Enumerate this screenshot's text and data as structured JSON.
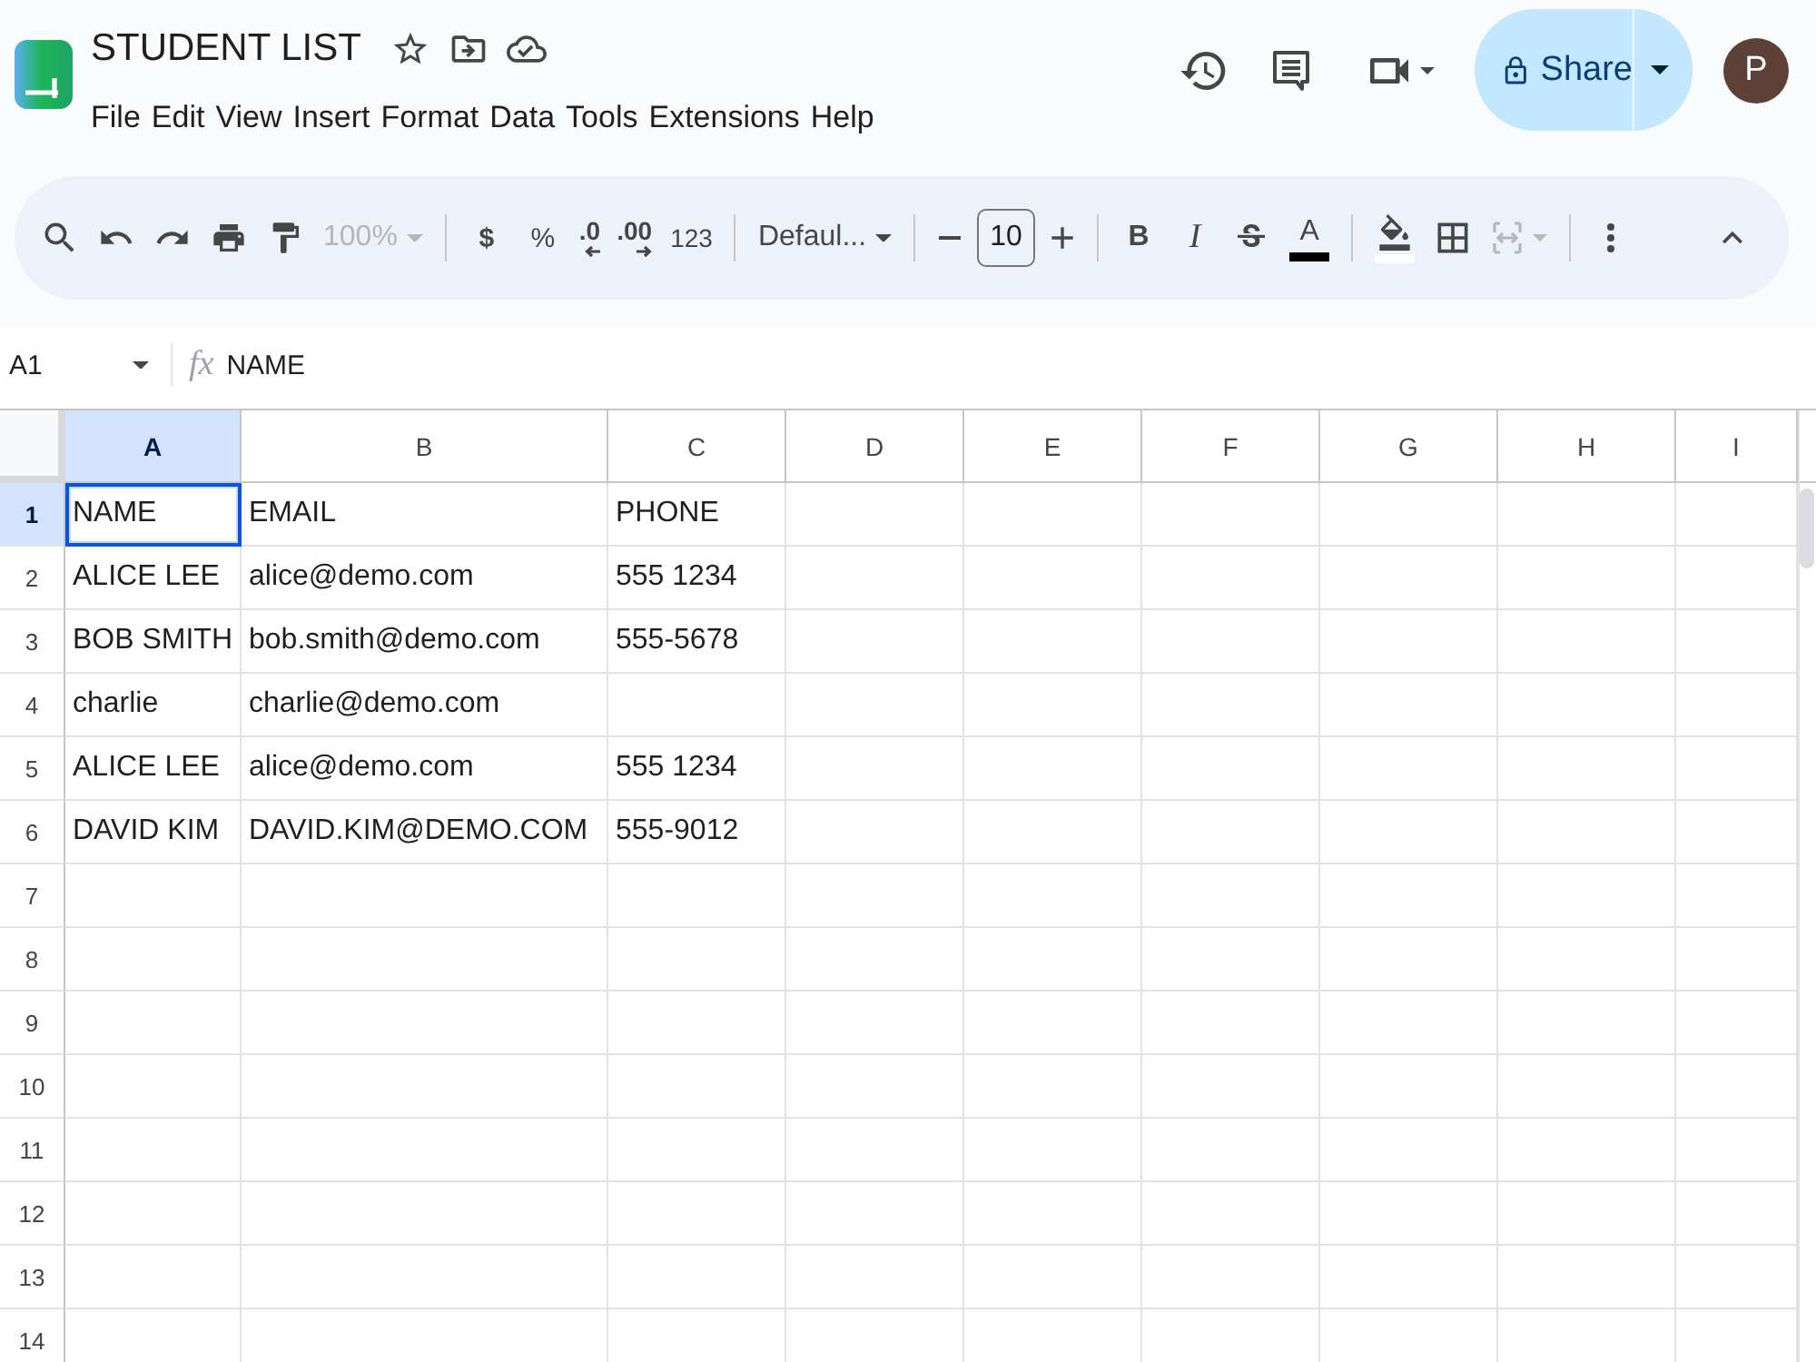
{
  "document": {
    "title": "STUDENT LIST"
  },
  "menu": [
    "File",
    "Edit",
    "View",
    "Insert",
    "Format",
    "Data",
    "Tools",
    "Extensions",
    "Help"
  ],
  "share": {
    "label": "Share"
  },
  "account": {
    "initial": "P"
  },
  "toolbar": {
    "zoom": {
      "label": "100%",
      "disabled": true
    },
    "currency": "$",
    "percent": "%",
    "decrease_decimals": ".0",
    "increase_decimals": ".00",
    "number_formats": "123",
    "font": "Defaul...",
    "font_size": "10",
    "bold": "B",
    "italic": "I",
    "text_color": "A",
    "merge": {
      "disabled": true
    }
  },
  "formula_bar": {
    "cell_reference": "A1",
    "label": "fx",
    "value": "NAME"
  },
  "sheet": {
    "columns": [
      {
        "label": "A",
        "selected": true
      },
      {
        "label": "B",
        "selected": false
      },
      {
        "label": "C",
        "selected": false
      },
      {
        "label": "D",
        "selected": false
      },
      {
        "label": "E",
        "selected": false
      },
      {
        "label": "F",
        "selected": false
      },
      {
        "label": "G",
        "selected": false
      },
      {
        "label": "H",
        "selected": false
      },
      {
        "label": "I",
        "selected": false
      }
    ],
    "rows": [
      {
        "number": "1",
        "selected": true,
        "cells": [
          {
            "text": "NAME",
            "selected": true
          },
          {
            "text": "EMAIL",
            "selected": false
          },
          {
            "text": "PHONE",
            "selected": false
          }
        ]
      },
      {
        "number": "2",
        "selected": false,
        "cells": [
          {
            "text": "ALICE LEE",
            "selected": false
          },
          {
            "text": "alice@demo.com",
            "selected": false
          },
          {
            "text": "555 1234",
            "selected": false
          }
        ]
      },
      {
        "number": "3",
        "selected": false,
        "cells": [
          {
            "text": "BOB SMITH",
            "selected": false
          },
          {
            "text": "bob.smith@demo.com",
            "selected": false
          },
          {
            "text": "555-5678",
            "selected": false
          }
        ]
      },
      {
        "number": "4",
        "selected": false,
        "cells": [
          {
            "text": "charlie",
            "selected": false
          },
          {
            "text": "charlie@demo.com",
            "selected": false
          }
        ]
      },
      {
        "number": "5",
        "selected": false,
        "cells": [
          {
            "text": "ALICE LEE",
            "selected": false
          },
          {
            "text": "alice@demo.com",
            "selected": false
          },
          {
            "text": "555 1234",
            "selected": false
          }
        ]
      },
      {
        "number": "6",
        "selected": false,
        "cells": [
          {
            "text": "DAVID KIM",
            "selected": false
          },
          {
            "text": "DAVID.KIM@DEMO.COM",
            "selected": false
          },
          {
            "text": "555-9012",
            "selected": false
          }
        ]
      },
      {
        "number": "7",
        "selected": false
      },
      {
        "number": "8",
        "selected": false
      },
      {
        "number": "9",
        "selected": false
      },
      {
        "number": "10",
        "selected": false
      },
      {
        "number": "11",
        "selected": false
      },
      {
        "number": "12",
        "selected": false
      },
      {
        "number": "13",
        "selected": false
      },
      {
        "number": "14",
        "selected": false
      }
    ]
  }
}
